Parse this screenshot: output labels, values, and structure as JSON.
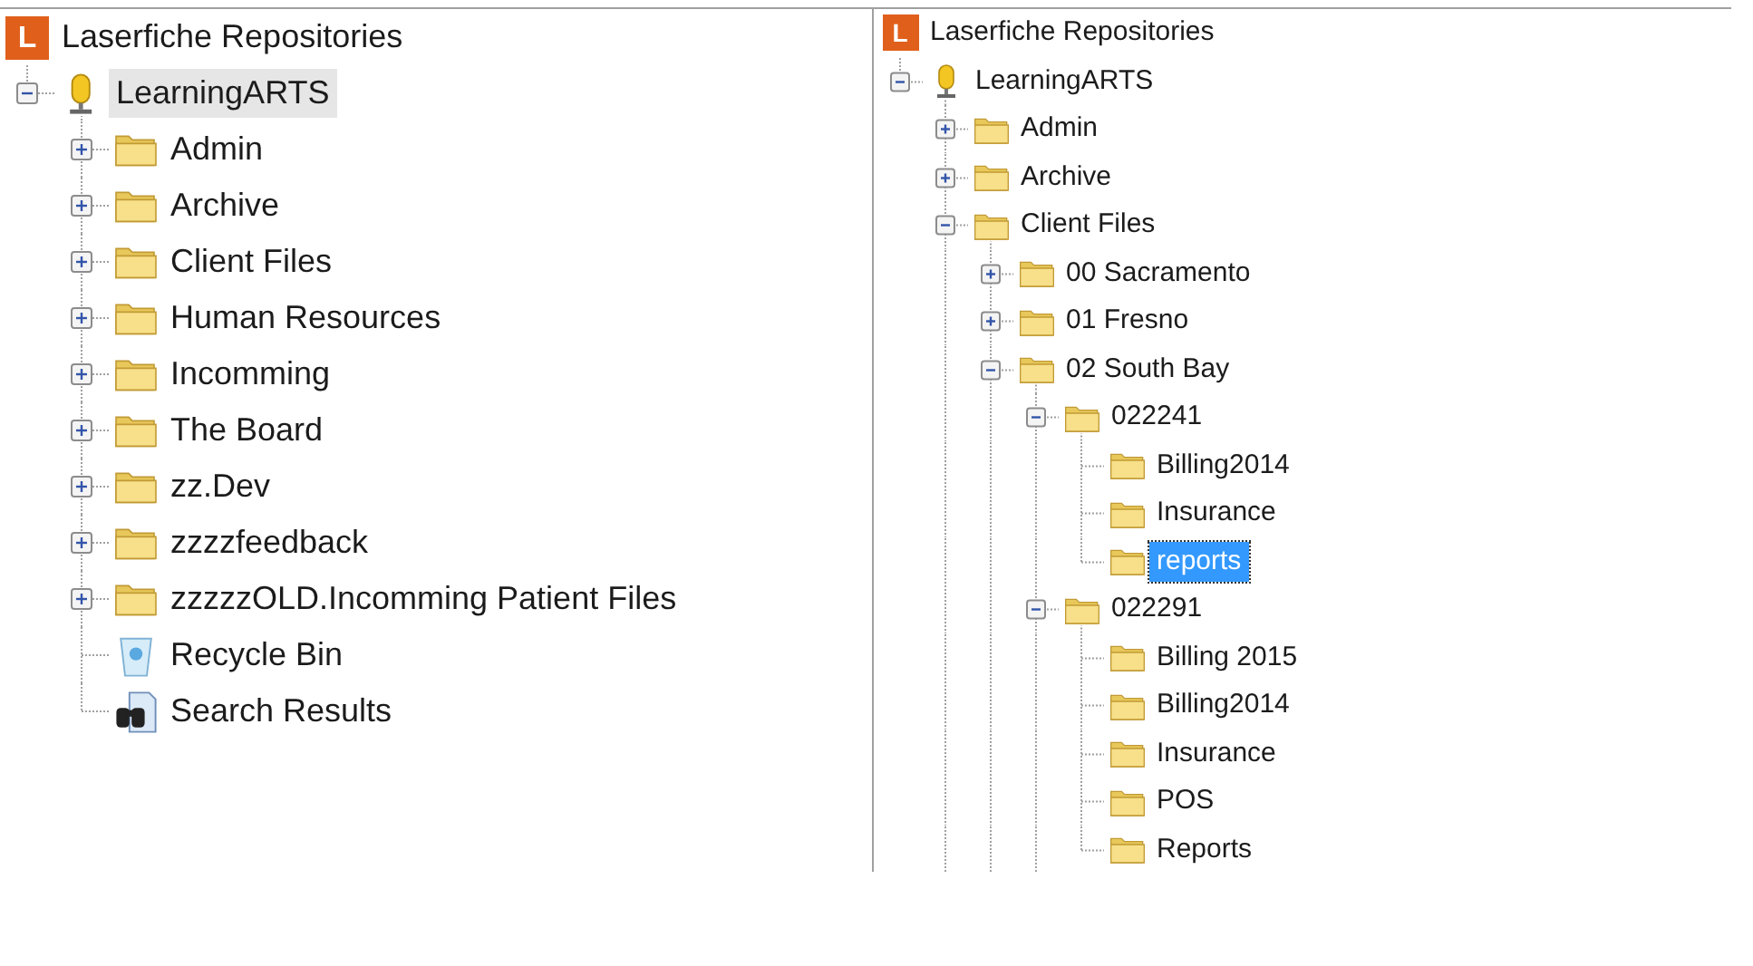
{
  "panels": [
    {
      "focused": false,
      "tree": {
        "kind": "root",
        "logo": "L",
        "label": "Laserfiche Repositories",
        "selected": false,
        "children": [
          {
            "kind": "repository",
            "label": "LearningARTS",
            "expanded": true,
            "selected": true,
            "children": [
              {
                "kind": "folder",
                "label": "Admin",
                "expanded": false,
                "selected": false
              },
              {
                "kind": "folder",
                "label": "Archive",
                "expanded": false,
                "selected": false
              },
              {
                "kind": "folder",
                "label": "Client Files",
                "expanded": false,
                "selected": false
              },
              {
                "kind": "folder",
                "label": "Human Resources",
                "expanded": false,
                "selected": false
              },
              {
                "kind": "folder",
                "label": "Incomming",
                "expanded": false,
                "selected": false
              },
              {
                "kind": "folder",
                "label": "The Board",
                "expanded": false,
                "selected": false
              },
              {
                "kind": "folder",
                "label": "zz.Dev",
                "expanded": false,
                "selected": false
              },
              {
                "kind": "folder",
                "label": "zzzzfeedback",
                "expanded": false,
                "selected": false
              },
              {
                "kind": "folder",
                "label": "zzzzzOLD.Incomming Patient Files",
                "expanded": false,
                "selected": false
              },
              {
                "kind": "recycle_bin",
                "label": "Recycle Bin",
                "selected": false
              },
              {
                "kind": "search_results",
                "label": "Search Results",
                "selected": false
              }
            ]
          }
        ]
      }
    },
    {
      "focused": true,
      "tree": {
        "kind": "root",
        "logo": "L",
        "label": "Laserfiche Repositories",
        "selected": false,
        "children": [
          {
            "kind": "repository",
            "label": "LearningARTS",
            "expanded": true,
            "selected": false,
            "children": [
              {
                "kind": "folder",
                "label": "Admin",
                "expanded": false,
                "selected": false
              },
              {
                "kind": "folder",
                "label": "Archive",
                "expanded": false,
                "selected": false
              },
              {
                "kind": "folder",
                "label": "Client Files",
                "expanded": true,
                "selected": false,
                "more_below": true,
                "children": [
                  {
                    "kind": "folder",
                    "label": "00 Sacramento",
                    "expanded": false,
                    "selected": false
                  },
                  {
                    "kind": "folder",
                    "label": "01 Fresno",
                    "expanded": false,
                    "selected": false
                  },
                  {
                    "kind": "folder",
                    "label": "02 South Bay",
                    "expanded": true,
                    "selected": false,
                    "more_below": true,
                    "children": [
                      {
                        "kind": "folder",
                        "label": "022241",
                        "expanded": true,
                        "selected": false,
                        "children": [
                          {
                            "kind": "folder",
                            "label": "Billing2014",
                            "selected": false
                          },
                          {
                            "kind": "folder",
                            "label": "Insurance",
                            "selected": false
                          },
                          {
                            "kind": "folder",
                            "label": "reports",
                            "selected": true
                          }
                        ]
                      },
                      {
                        "kind": "folder",
                        "label": "022291",
                        "expanded": true,
                        "selected": false,
                        "more_below": true,
                        "children": [
                          {
                            "kind": "folder",
                            "label": "Billing 2015",
                            "selected": false
                          },
                          {
                            "kind": "folder",
                            "label": "Billing2014",
                            "selected": false
                          },
                          {
                            "kind": "folder",
                            "label": "Insurance",
                            "selected": false
                          },
                          {
                            "kind": "folder",
                            "label": "POS",
                            "selected": false
                          },
                          {
                            "kind": "folder",
                            "label": "Reports",
                            "selected": false
                          }
                        ]
                      }
                    ]
                  }
                ]
              }
            ]
          }
        ]
      }
    }
  ]
}
